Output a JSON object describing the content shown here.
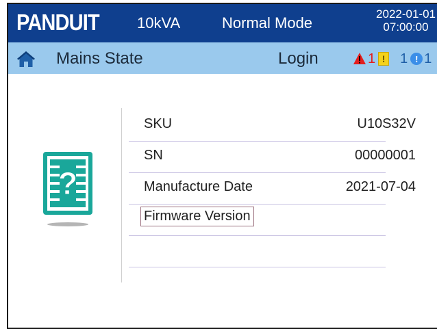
{
  "header": {
    "logo": "PANDUIT",
    "rating": "10kVA",
    "mode": "Normal Mode",
    "date": "2022-01-01",
    "time": "07:00:00"
  },
  "subbar": {
    "home_icon": "home-icon",
    "title": "Mains State",
    "login_label": "Login",
    "alarms": {
      "critical_count": "1",
      "warning_count": "1",
      "info_count": "1"
    }
  },
  "info": {
    "icon": "question-document-icon",
    "rows": [
      {
        "label": "SKU",
        "value": "U10S32V"
      },
      {
        "label": "SN",
        "value": "00000001"
      },
      {
        "label": "Manufacture Date",
        "value": "2021-07-04"
      },
      {
        "label": "Firmware Version",
        "value": ""
      }
    ]
  },
  "colors": {
    "header_bg": "#0f3f8e",
    "subbar_bg": "#9ac9ed",
    "icon_teal": "#1aa79a",
    "alarm_red": "#e41d1d",
    "alarm_yellow": "#f4d21c",
    "alarm_blue": "#3b8ee8"
  }
}
